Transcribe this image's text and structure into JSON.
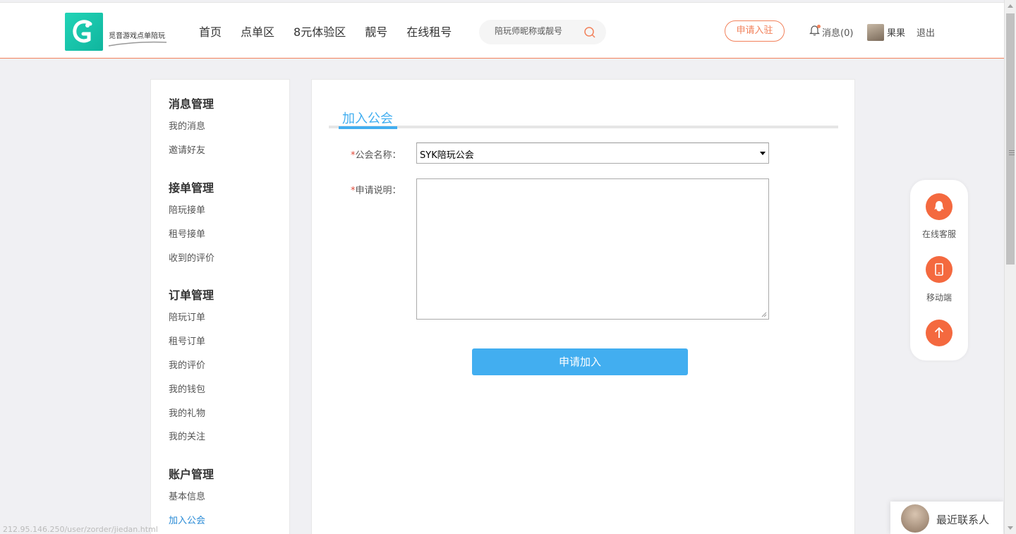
{
  "header": {
    "logo_text": "觅音游戏点单陪玩",
    "nav": [
      "首页",
      "点单区",
      "8元体验区",
      "靓号",
      "在线租号"
    ],
    "search_placeholder": "陪玩师昵称或靓号",
    "apply_label": "申请入驻",
    "messages_label": "消息(0)",
    "username": "果果",
    "logout_label": "退出"
  },
  "sidebar": {
    "groups": [
      {
        "title": "消息管理",
        "items": [
          "我的消息",
          "邀请好友"
        ]
      },
      {
        "title": "接单管理",
        "items": [
          "陪玩接单",
          "租号接单",
          "收到的评价"
        ]
      },
      {
        "title": "订单管理",
        "items": [
          "陪玩订单",
          "租号订单",
          "我的评价",
          "我的钱包",
          "我的礼物",
          "我的关注"
        ]
      },
      {
        "title": "账户管理",
        "items": [
          "基本信息",
          "加入公会"
        ]
      }
    ],
    "active_item": "加入公会"
  },
  "main": {
    "tab_title": "加入公会",
    "guild_label": "公会名称：",
    "guild_value": "SYK陪玩公会",
    "desc_label": "申请说明：",
    "required_mark": "*",
    "submit_label": "申请加入"
  },
  "float_widget": {
    "items": [
      "在线客服",
      "移动端"
    ]
  },
  "recent_contacts_label": "最近联系人",
  "status_url": "212.95.146.250/user/zorder/jiedan.html",
  "colors": {
    "accent_blue": "#42aef0",
    "accent_orange": "#f2815b",
    "float_orange": "#f4693f"
  }
}
